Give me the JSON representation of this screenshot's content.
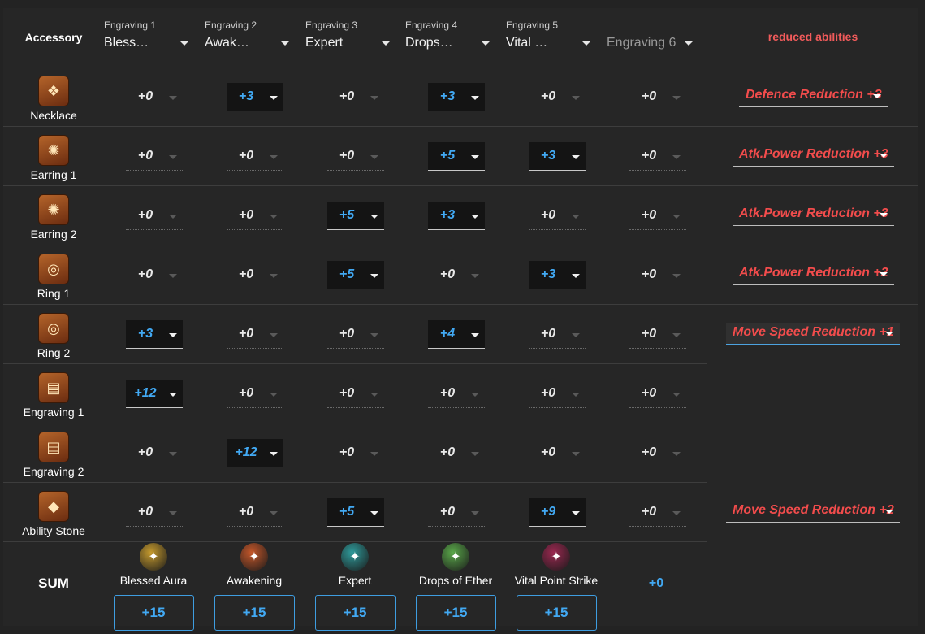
{
  "header": {
    "accessory_label": "Accessory",
    "reduced_label": "reduced abilities",
    "engravings": [
      {
        "label": "Engraving 1",
        "value": "Bless…"
      },
      {
        "label": "Engraving 2",
        "value": "Awak…"
      },
      {
        "label": "Engraving 3",
        "value": "Expert"
      },
      {
        "label": "Engraving 4",
        "value": "Drops…"
      },
      {
        "label": "Engraving 5",
        "value": "Vital …"
      },
      {
        "label": "",
        "value": "Engraving 6"
      }
    ]
  },
  "rows": [
    {
      "name": "Necklace",
      "icon": "necklace-icon",
      "values": [
        "+0",
        "+3",
        "+0",
        "+3",
        "+0",
        "+0"
      ],
      "reduced": "Defence Reduction +3"
    },
    {
      "name": "Earring 1",
      "icon": "earring-icon",
      "values": [
        "+0",
        "+0",
        "+0",
        "+5",
        "+3",
        "+0"
      ],
      "reduced": "Atk.Power Reduction +3"
    },
    {
      "name": "Earring 2",
      "icon": "earring-icon",
      "values": [
        "+0",
        "+0",
        "+5",
        "+3",
        "+0",
        "+0"
      ],
      "reduced": "Atk.Power Reduction +3"
    },
    {
      "name": "Ring 1",
      "icon": "ring-icon",
      "values": [
        "+0",
        "+0",
        "+5",
        "+0",
        "+3",
        "+0"
      ],
      "reduced": "Atk.Power Reduction +2"
    },
    {
      "name": "Ring 2",
      "icon": "ring-icon",
      "values": [
        "+3",
        "+0",
        "+0",
        "+4",
        "+0",
        "+0"
      ],
      "reduced": "Move Speed Reduction +1"
    },
    {
      "name": "Engraving 1",
      "icon": "engraving-book-icon",
      "values": [
        "+12",
        "+0",
        "+0",
        "+0",
        "+0",
        "+0"
      ],
      "reduced": ""
    },
    {
      "name": "Engraving 2",
      "icon": "engraving-book-icon",
      "values": [
        "+0",
        "+12",
        "+0",
        "+0",
        "+0",
        "+0"
      ],
      "reduced": ""
    },
    {
      "name": "Ability Stone",
      "icon": "ability-stone-icon",
      "values": [
        "+0",
        "+0",
        "+5",
        "+0",
        "+9",
        "+0"
      ],
      "reduced": "Move Speed Reduction +2"
    }
  ],
  "sum": {
    "label": "SUM",
    "columns": [
      {
        "name": "Blessed Aura",
        "value": "+15",
        "icon": "blessed-aura-icon",
        "color": "#c59a2e"
      },
      {
        "name": "Awakening",
        "value": "+15",
        "icon": "awakening-icon",
        "color": "#c4572a"
      },
      {
        "name": "Expert",
        "value": "+15",
        "icon": "expert-icon",
        "color": "#2f9a9a"
      },
      {
        "name": "Drops of Ether",
        "value": "+15",
        "icon": "drops-of-ether-icon",
        "color": "#5aa84a"
      },
      {
        "name": "Vital Point Strike",
        "value": "+15",
        "icon": "vital-point-strike-icon",
        "color": "#9a2850"
      }
    ],
    "sixth": "+0"
  },
  "colors": {
    "positive": "#42a9f3",
    "reduction": "#f24c4c",
    "background": "#262626"
  }
}
